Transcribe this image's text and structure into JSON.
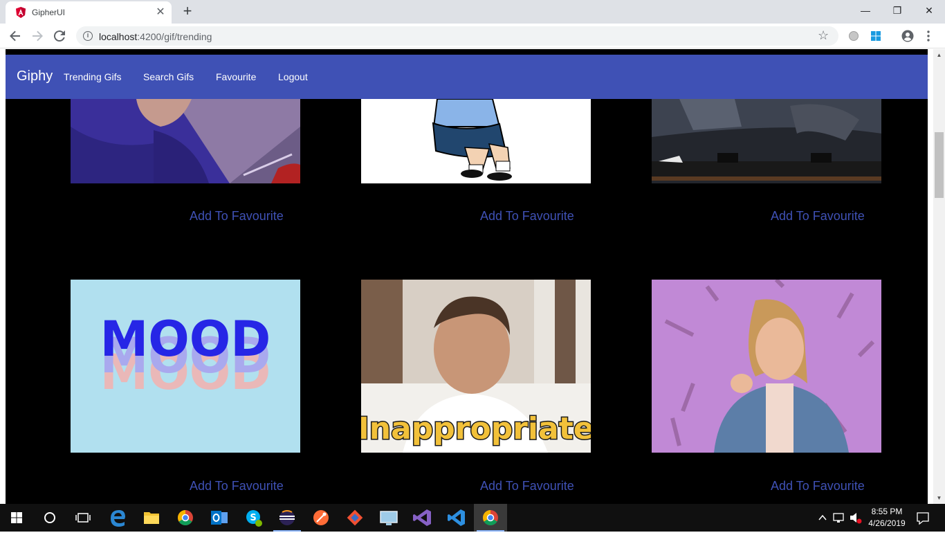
{
  "browser": {
    "tab_title": "GipherUI",
    "tab_close": "✕",
    "new_tab": "+",
    "url_host": "localhost",
    "url_path": ":4200/gif/trending",
    "window_controls": [
      "—",
      "❐",
      "✕"
    ]
  },
  "navbar": {
    "brand": "Giphy",
    "links": [
      "Trending Gifs",
      "Search Gifs",
      "Favourite",
      "Logout"
    ]
  },
  "cards": [
    {
      "action": "Add To Favourite",
      "image": "cartoon-hero"
    },
    {
      "action": "Add To Favourite",
      "image": "cartoon-legs"
    },
    {
      "action": "Add To Favourite",
      "image": "talk-show"
    },
    {
      "action": "Add To Favourite",
      "image": "mood-text",
      "image_text": "MOOD"
    },
    {
      "action": "Add To Favourite",
      "image": "man-inappropriate",
      "image_text": "Inappropriate"
    },
    {
      "action": "Add To Favourite",
      "image": "woman-pointing"
    }
  ],
  "taskbar": {
    "time": "8:55 PM",
    "date": "4/26/2019"
  },
  "colors": {
    "navbar": "#3f51b5",
    "link": "#3f51b5",
    "page_bg": "#000000"
  }
}
